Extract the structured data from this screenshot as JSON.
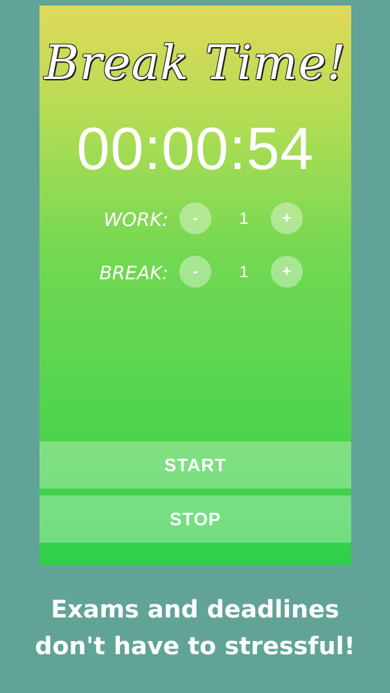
{
  "app": {
    "title": "Break Time!",
    "timer": "00:00:54"
  },
  "settings": {
    "work": {
      "label": "WORK:",
      "minus": "-",
      "value": "1",
      "plus": "+"
    },
    "break": {
      "label": "BREAK:",
      "minus": "-",
      "value": "1",
      "plus": "+"
    }
  },
  "actions": {
    "start_label": "START",
    "stop_label": "STOP"
  },
  "tagline": {
    "line1": "Exams and deadlines",
    "line2": "don't have to stressful!"
  },
  "colors": {
    "background": "#62a397",
    "gradient_top": "#e0d95a",
    "gradient_bottom": "#2fcf4a",
    "text": "#ffffff"
  }
}
